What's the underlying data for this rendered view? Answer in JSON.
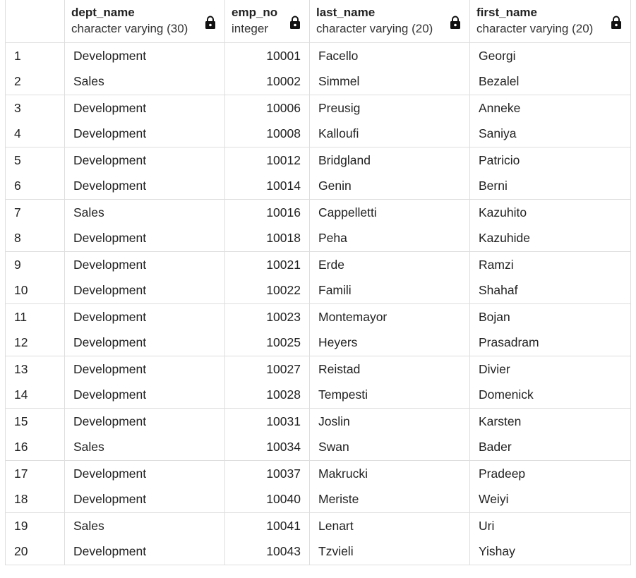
{
  "columns": [
    {
      "name": "dept_name",
      "type": "character varying (30)",
      "icon": "lock-icon"
    },
    {
      "name": "emp_no",
      "type": "integer",
      "icon": "lock-icon"
    },
    {
      "name": "last_name",
      "type": "character varying (20)",
      "icon": "lock-icon"
    },
    {
      "name": "first_name",
      "type": "character varying (20)",
      "icon": "lock-icon"
    }
  ],
  "rows": [
    {
      "n": "1",
      "dept_name": "Development",
      "emp_no": "10001",
      "last_name": "Facello",
      "first_name": "Georgi"
    },
    {
      "n": "2",
      "dept_name": "Sales",
      "emp_no": "10002",
      "last_name": "Simmel",
      "first_name": "Bezalel"
    },
    {
      "n": "3",
      "dept_name": "Development",
      "emp_no": "10006",
      "last_name": "Preusig",
      "first_name": "Anneke"
    },
    {
      "n": "4",
      "dept_name": "Development",
      "emp_no": "10008",
      "last_name": "Kalloufi",
      "first_name": "Saniya"
    },
    {
      "n": "5",
      "dept_name": "Development",
      "emp_no": "10012",
      "last_name": "Bridgland",
      "first_name": "Patricio"
    },
    {
      "n": "6",
      "dept_name": "Development",
      "emp_no": "10014",
      "last_name": "Genin",
      "first_name": "Berni"
    },
    {
      "n": "7",
      "dept_name": "Sales",
      "emp_no": "10016",
      "last_name": "Cappelletti",
      "first_name": "Kazuhito"
    },
    {
      "n": "8",
      "dept_name": "Development",
      "emp_no": "10018",
      "last_name": "Peha",
      "first_name": "Kazuhide"
    },
    {
      "n": "9",
      "dept_name": "Development",
      "emp_no": "10021",
      "last_name": "Erde",
      "first_name": "Ramzi"
    },
    {
      "n": "10",
      "dept_name": "Development",
      "emp_no": "10022",
      "last_name": "Famili",
      "first_name": "Shahaf"
    },
    {
      "n": "11",
      "dept_name": "Development",
      "emp_no": "10023",
      "last_name": "Montemayor",
      "first_name": "Bojan"
    },
    {
      "n": "12",
      "dept_name": "Development",
      "emp_no": "10025",
      "last_name": "Heyers",
      "first_name": "Prasadram"
    },
    {
      "n": "13",
      "dept_name": "Development",
      "emp_no": "10027",
      "last_name": "Reistad",
      "first_name": "Divier"
    },
    {
      "n": "14",
      "dept_name": "Development",
      "emp_no": "10028",
      "last_name": "Tempesti",
      "first_name": "Domenick"
    },
    {
      "n": "15",
      "dept_name": "Development",
      "emp_no": "10031",
      "last_name": "Joslin",
      "first_name": "Karsten"
    },
    {
      "n": "16",
      "dept_name": "Sales",
      "emp_no": "10034",
      "last_name": "Swan",
      "first_name": "Bader"
    },
    {
      "n": "17",
      "dept_name": "Development",
      "emp_no": "10037",
      "last_name": "Makrucki",
      "first_name": "Pradeep"
    },
    {
      "n": "18",
      "dept_name": "Development",
      "emp_no": "10040",
      "last_name": "Meriste",
      "first_name": "Weiyi"
    },
    {
      "n": "19",
      "dept_name": "Sales",
      "emp_no": "10041",
      "last_name": "Lenart",
      "first_name": "Uri"
    },
    {
      "n": "20",
      "dept_name": "Development",
      "emp_no": "10043",
      "last_name": "Tzvieli",
      "first_name": "Yishay"
    }
  ]
}
